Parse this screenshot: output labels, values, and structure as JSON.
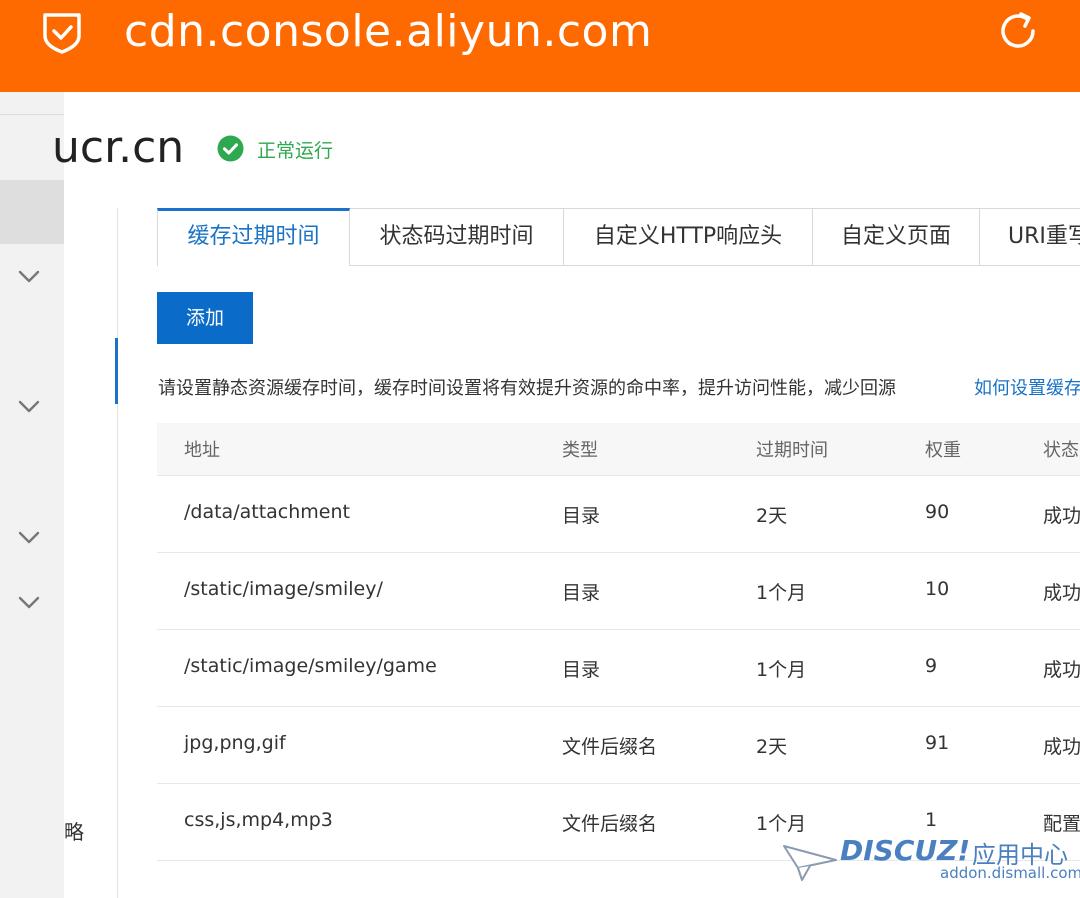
{
  "browser": {
    "url": "cdn.console.aliyun.com",
    "icons": {
      "security": "shield-check-icon",
      "reload": "reload-icon"
    }
  },
  "sidebar": {
    "partial_label": "略"
  },
  "header": {
    "domain": "ucr.cn",
    "status": "正常运行",
    "status_color": "#2fa94f"
  },
  "tabs": [
    {
      "label": "缓存过期时间",
      "active": true
    },
    {
      "label": "状态码过期时间",
      "active": false
    },
    {
      "label": "自定义HTTP响应头",
      "active": false
    },
    {
      "label": "自定义页面",
      "active": false
    },
    {
      "label": "URI重写",
      "active": false
    }
  ],
  "toolbar": {
    "add_label": "添加"
  },
  "hint": {
    "text": "请设置静态资源缓存时间，缓存时间设置将有效提升资源的命中率，提升访问性能，减少回源",
    "link": "如何设置缓存"
  },
  "table": {
    "columns": [
      "地址",
      "类型",
      "过期时间",
      "权重",
      "状态"
    ],
    "rows": [
      [
        "/data/attachment",
        "目录",
        "2天",
        "90",
        "成功"
      ],
      [
        "/static/image/smiley/",
        "目录",
        "1个月",
        "10",
        "成功"
      ],
      [
        "/static/image/smiley/game",
        "目录",
        "1个月",
        "9",
        "成功"
      ],
      [
        "jpg,png,gif",
        "文件后缀名",
        "2天",
        "91",
        "成功"
      ],
      [
        "css,js,mp4,mp3",
        "文件后缀名",
        "1个月",
        "1",
        "配置"
      ]
    ]
  },
  "watermark": {
    "brand": "DISCUZ!",
    "brand_cn": "应用中心",
    "url": "addon.dismall.com"
  },
  "colors": {
    "topbar": "#ff6a00",
    "accent": "#1a73c8",
    "button": "#0b6bc9"
  }
}
